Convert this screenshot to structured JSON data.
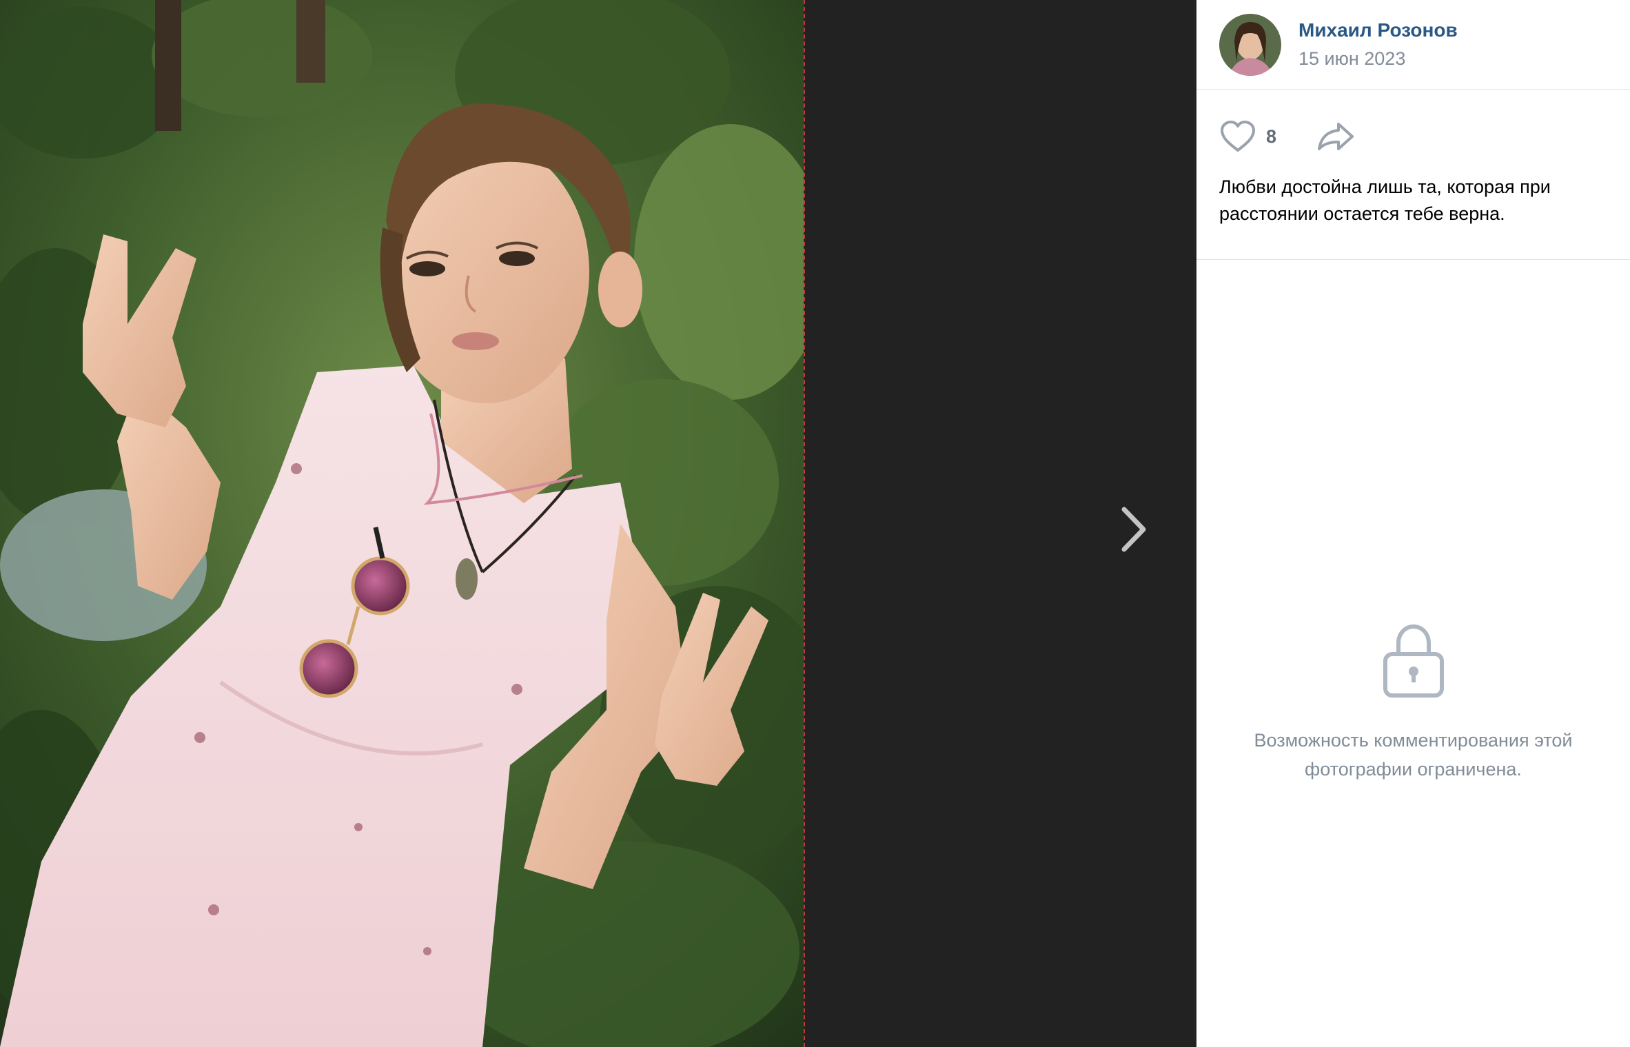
{
  "photo": {
    "description_icon": "photo",
    "next_icon": "chevron-right-icon"
  },
  "post": {
    "author_name": "Михаил Розонов",
    "date": "15 июн 2023",
    "likes_count": "8",
    "caption": "Любви достойна лишь та, которая при расстоянии остается тебе верна."
  },
  "comments": {
    "restricted_message": "Возможность комментирования этой фотографии ограничена."
  },
  "colors": {
    "viewer_background": "#222222",
    "link_blue": "#2a5885",
    "secondary_gray": "#818c99",
    "icon_gray": "#99a2ad"
  }
}
